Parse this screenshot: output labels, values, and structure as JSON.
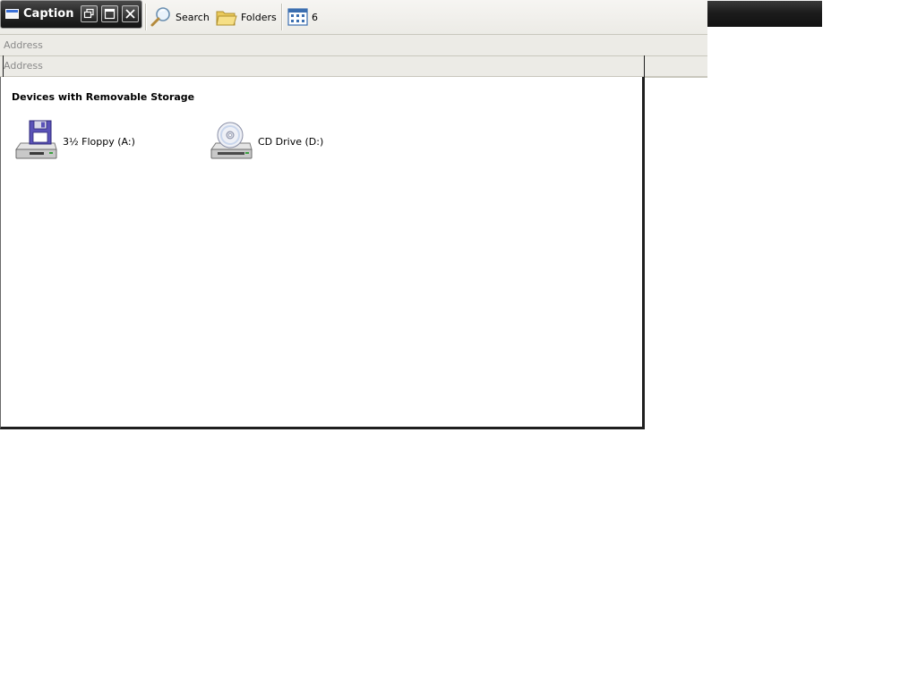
{
  "window": {
    "caption": "Caption"
  },
  "toolbar": {
    "search_label": "Search",
    "folders_label": "Folders",
    "views_label": "6"
  },
  "address_bars": [
    {
      "label": "Address"
    },
    {
      "label": "Address"
    }
  ],
  "content": {
    "group_header": "Devices with Removable Storage",
    "devices": [
      {
        "label": "3½ Floppy (A:)",
        "icon": "floppy-drive-icon"
      },
      {
        "label": "CD Drive (D:)",
        "icon": "cd-drive-icon"
      }
    ]
  },
  "colors": {
    "caption_bar": "#1f1f1f",
    "toolbar_bg": "#ecebe6",
    "floppy_accent": "#5a52b8"
  }
}
